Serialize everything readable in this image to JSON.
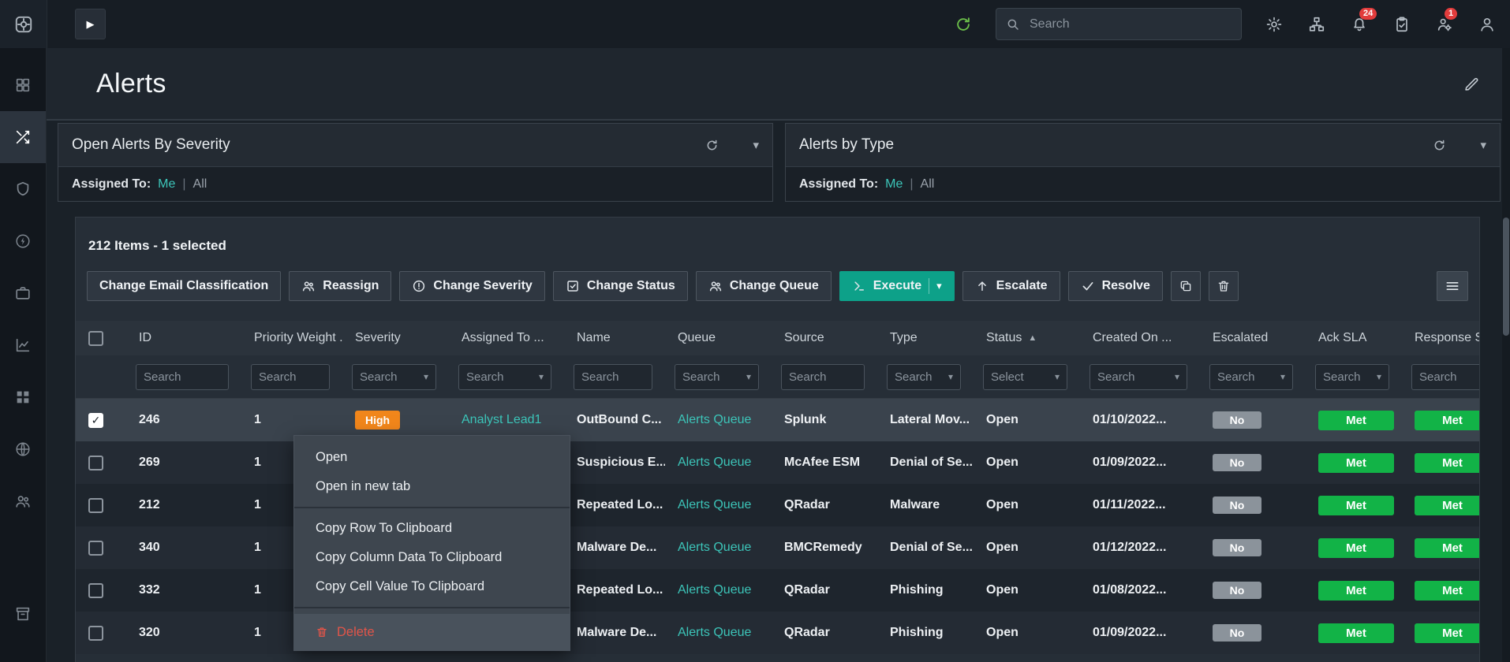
{
  "colors": {
    "accent_teal": "#3cc5b9",
    "severity_high": "#f1861b",
    "sla_met_green": "#12b347",
    "escalated_no_gray": "#8b939b",
    "delete_red": "#e25549",
    "execute_button": "#0da189"
  },
  "icons": {
    "play": "▶",
    "caret_down": "▾",
    "sort_asc": "▲",
    "check": "✓"
  },
  "topbar": {
    "search_placeholder": "Search",
    "notifications_badge": "24",
    "services_badge": "1"
  },
  "sidebar": {
    "items": [
      "dashboard",
      "workflow",
      "shield",
      "automation",
      "case",
      "analytics",
      "apps",
      "network",
      "users",
      "archive"
    ],
    "active_item": "workflow"
  },
  "page": {
    "title": "Alerts"
  },
  "panels": [
    {
      "title": "Open Alerts By Severity",
      "assigned_to_label": "Assigned To:",
      "me_link": "Me",
      "separator": "|",
      "all_link": "All"
    },
    {
      "title": "Alerts by Type",
      "assigned_to_label": "Assigned To:",
      "me_link": "Me",
      "separator": "|",
      "all_link": "All"
    }
  ],
  "alerts_table": {
    "summary": "212 Items - 1 selected",
    "toolbar": {
      "change_email_classification": "Change Email Classification",
      "reassign": "Reassign",
      "change_severity": "Change Severity",
      "change_status": "Change Status",
      "change_queue": "Change Queue",
      "execute": "Execute",
      "escalate": "Escalate",
      "resolve": "Resolve"
    },
    "columns": [
      {
        "label": "ID",
        "filter": "Search"
      },
      {
        "label": "Priority Weight ...",
        "filter": "Search"
      },
      {
        "label": "Severity",
        "filter": "Search"
      },
      {
        "label": "Assigned To ...",
        "filter": "Search"
      },
      {
        "label": "Name",
        "filter": "Search"
      },
      {
        "label": "Queue",
        "filter": "Search"
      },
      {
        "label": "Source",
        "filter": "Search"
      },
      {
        "label": "Type",
        "filter": "Search"
      },
      {
        "label": "Status",
        "filter": "Select"
      },
      {
        "label": "Created On ...",
        "filter": "Search"
      },
      {
        "label": "Escalated",
        "filter": "Search"
      },
      {
        "label": "Ack SLA",
        "filter": "Search"
      },
      {
        "label": "Response S...",
        "filter": "Search"
      }
    ],
    "rows": [
      {
        "selected": true,
        "id": "246",
        "priority_weight": "1",
        "severity": "High",
        "assigned_to": "Analyst Lead1",
        "name": "OutBound C...",
        "queue": "Alerts Queue",
        "source": "Splunk",
        "type": "Lateral Mov...",
        "status": "Open",
        "created_on": "01/10/2022...",
        "escalated": "No",
        "ack_sla": "Met",
        "response_sla": "Met"
      },
      {
        "selected": false,
        "id": "269",
        "priority_weight": "1",
        "severity": "",
        "assigned_to": "",
        "name": "Suspicious E...",
        "queue": "Alerts Queue",
        "source": "McAfee ESM",
        "type": "Denial of Se...",
        "status": "Open",
        "created_on": "01/09/2022...",
        "escalated": "No",
        "ack_sla": "Met",
        "response_sla": "Met"
      },
      {
        "selected": false,
        "id": "212",
        "priority_weight": "1",
        "severity": "",
        "assigned_to": "",
        "name": "Repeated Lo...",
        "queue": "Alerts Queue",
        "source": "QRadar",
        "type": "Malware",
        "status": "Open",
        "created_on": "01/11/2022...",
        "escalated": "No",
        "ack_sla": "Met",
        "response_sla": "Met"
      },
      {
        "selected": false,
        "id": "340",
        "priority_weight": "1",
        "severity": "",
        "assigned_to": "",
        "name": "Malware De...",
        "queue": "Alerts Queue",
        "source": "BMCRemedy",
        "type": "Denial of Se...",
        "status": "Open",
        "created_on": "01/12/2022...",
        "escalated": "No",
        "ack_sla": "Met",
        "response_sla": "Met"
      },
      {
        "selected": false,
        "id": "332",
        "priority_weight": "1",
        "severity": "",
        "assigned_to": "",
        "name": "Repeated Lo...",
        "queue": "Alerts Queue",
        "source": "QRadar",
        "type": "Phishing",
        "status": "Open",
        "created_on": "01/08/2022...",
        "escalated": "No",
        "ack_sla": "Met",
        "response_sla": "Met"
      },
      {
        "selected": false,
        "id": "320",
        "priority_weight": "1",
        "severity": "",
        "assigned_to": "",
        "name": "Malware De...",
        "queue": "Alerts Queue",
        "source": "QRadar",
        "type": "Phishing",
        "status": "Open",
        "created_on": "01/09/2022...",
        "escalated": "No",
        "ack_sla": "Met",
        "response_sla": "Met"
      }
    ]
  },
  "context_menu": {
    "open": "Open",
    "open_in_new_tab": "Open in new tab",
    "copy_row": "Copy Row To Clipboard",
    "copy_column": "Copy Column Data To Clipboard",
    "copy_cell": "Copy Cell Value To Clipboard",
    "delete": "Delete"
  }
}
